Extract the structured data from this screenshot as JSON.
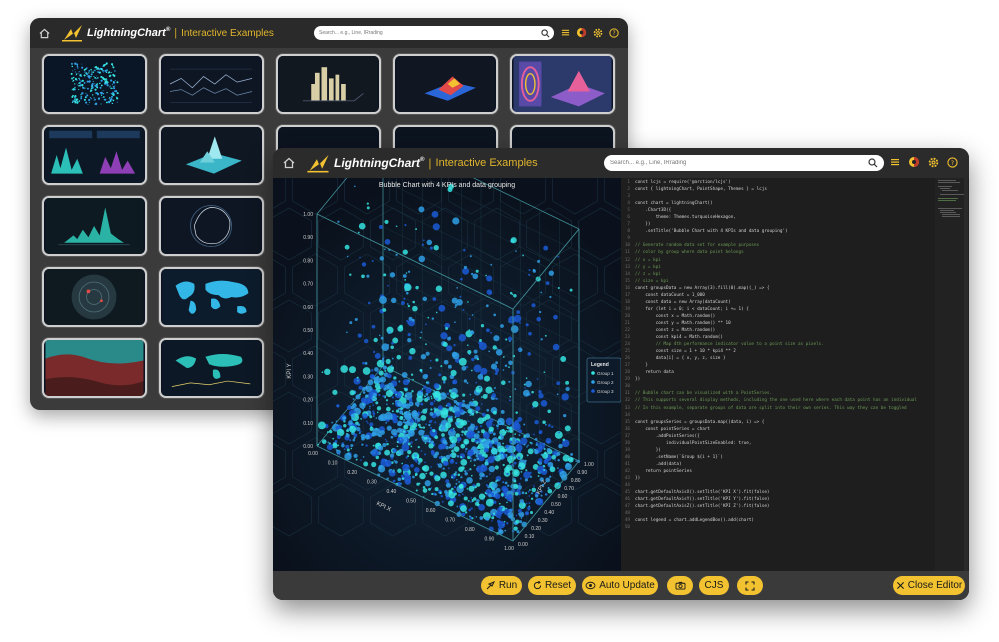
{
  "app": {
    "brand": "LightningChart",
    "brand_mark": "®",
    "subtitle": "Interactive Examples",
    "search_placeholder": "Search... e.g., Line, IRrading",
    "accent": "#f2c230",
    "icons": [
      "home-icon",
      "search-icon",
      "list-icon",
      "theme-icon",
      "settings-icon",
      "help-icon"
    ]
  },
  "gallery": {
    "thumbnails": [
      "scatter-3d",
      "line-series",
      "city-bars-3d",
      "surface-3d",
      "heatmap-surface",
      "dashboard",
      "surface-mesh",
      "",
      "",
      "",
      "bars-3d",
      "polar",
      "",
      "",
      "",
      "radar",
      "world-map",
      "",
      "",
      "",
      "heatmap-map",
      "map-lines",
      "",
      "",
      ""
    ]
  },
  "chart": {
    "title": "Bubble Chart with 4 KPIs and data grouping",
    "axis_x": "KPI X",
    "axis_y": "KPI Y",
    "axis_z": "KPI Z",
    "legend_title": "Legend",
    "groups": [
      "Group 1",
      "Group 2",
      "Group 3"
    ],
    "group_colors": [
      "#35e3e0",
      "#2f9fe6",
      "#1b5ad6"
    ],
    "ticks": [
      "0.00",
      "0.10",
      "0.20",
      "0.30",
      "0.40",
      "0.50",
      "0.60",
      "0.70",
      "0.80",
      "0.90",
      "1.00"
    ]
  },
  "chart_data": {
    "type": "scatter",
    "title": "Bubble Chart with 4 KPIs and data grouping",
    "xlabel": "KPI X",
    "ylabel": "KPI Y",
    "zlabel": "KPI Z",
    "xlim": [
      0,
      1
    ],
    "ylim": [
      0,
      1
    ],
    "zlim": [
      0,
      1
    ],
    "legend_position": "right",
    "series": [
      {
        "name": "Group 1",
        "color": "#35e3e0"
      },
      {
        "name": "Group 2",
        "color": "#2f9fe6"
      },
      {
        "name": "Group 3",
        "color": "#1b5ad6"
      }
    ]
  },
  "editor": {
    "lines": [
      {
        "n": "1",
        "t": "const lcjs = require('@arction/lcjs')",
        "c": false
      },
      {
        "n": "2",
        "t": "const { lightningChart, PointShape, Themes } = lcjs",
        "c": false
      },
      {
        "n": "3",
        "t": "",
        "c": false
      },
      {
        "n": "4",
        "t": "const chart = lightningChart()",
        "c": false
      },
      {
        "n": "5",
        "t": "    .Chart3D({",
        "c": false
      },
      {
        "n": "6",
        "t": "        theme: Themes.turquoiseHexagon,",
        "c": false
      },
      {
        "n": "7",
        "t": "    })",
        "c": false
      },
      {
        "n": "8",
        "t": "    .setTitle('Bubble Chart with 4 KPIs and data grouping')",
        "c": false
      },
      {
        "n": "9",
        "t": "",
        "c": false
      },
      {
        "n": "10",
        "t": "// Generate random data set for example purposes",
        "c": true
      },
      {
        "n": "11",
        "t": "// color by group where data point belongs",
        "c": true
      },
      {
        "n": "12",
        "t": "// x = kpi",
        "c": true
      },
      {
        "n": "13",
        "t": "// y = kpi",
        "c": true
      },
      {
        "n": "14",
        "t": "// z = kpi",
        "c": true
      },
      {
        "n": "15",
        "t": "// size = kpi",
        "c": true
      },
      {
        "n": "16",
        "t": "const groupsData = new Array(3).fill(0).map((_) => {",
        "c": false
      },
      {
        "n": "17",
        "t": "    const dataCount = 1_000",
        "c": false
      },
      {
        "n": "18",
        "t": "    const data = new Array(dataCount)",
        "c": false
      },
      {
        "n": "19",
        "t": "    for (let i = 0; i < dataCount; i += 1) {",
        "c": false
      },
      {
        "n": "20",
        "t": "        const x = Math.random()",
        "c": false
      },
      {
        "n": "21",
        "t": "        const y = Math.random() ** 10",
        "c": false
      },
      {
        "n": "22",
        "t": "        const z = Math.random()",
        "c": false
      },
      {
        "n": "23",
        "t": "        const kpi4 = Math.random()",
        "c": false
      },
      {
        "n": "24",
        "t": "        // Map 4th performance indicator value to a point size as pixels.",
        "c": true
      },
      {
        "n": "25",
        "t": "        const size = 1 + 10 * kpi4 ** 2",
        "c": false
      },
      {
        "n": "26",
        "t": "        data[i] = { x, y, z, size }",
        "c": false
      },
      {
        "n": "27",
        "t": "    }",
        "c": false
      },
      {
        "n": "28",
        "t": "    return data",
        "c": false
      },
      {
        "n": "29",
        "t": "})",
        "c": false
      },
      {
        "n": "30",
        "t": "",
        "c": false
      },
      {
        "n": "31",
        "t": "// Bubble chart can be visualized with a PointSeries.",
        "c": true
      },
      {
        "n": "32",
        "t": "// This supports several display methods, including the one used here where each data point has an individual",
        "c": true
      },
      {
        "n": "33",
        "t": "// In this example, separate groups of data are split into their own series. This way they can be toggled",
        "c": true
      },
      {
        "n": "34",
        "t": "",
        "c": false
      },
      {
        "n": "35",
        "t": "const groupsSeries = groupsData.map((data, i) => {",
        "c": false
      },
      {
        "n": "36",
        "t": "    const pointSeries = chart",
        "c": false
      },
      {
        "n": "37",
        "t": "        .addPointSeries({",
        "c": false
      },
      {
        "n": "38",
        "t": "            individualPointSizeEnabled: true,",
        "c": false
      },
      {
        "n": "39",
        "t": "        })",
        "c": false
      },
      {
        "n": "40",
        "t": "        .setName(`Group ${i + 1}`)",
        "c": false
      },
      {
        "n": "41",
        "t": "        .add(data)",
        "c": false
      },
      {
        "n": "42",
        "t": "    return pointSeries",
        "c": false
      },
      {
        "n": "43",
        "t": "})",
        "c": false
      },
      {
        "n": "44",
        "t": "",
        "c": false
      },
      {
        "n": "45",
        "t": "chart.getDefaultAxisX().setTitle('KPI X').fit(false)",
        "c": false
      },
      {
        "n": "46",
        "t": "chart.getDefaultAxisY().setTitle('KPI Y').fit(false)",
        "c": false
      },
      {
        "n": "47",
        "t": "chart.getDefaultAxisZ().setTitle('KPI Z').fit(false)",
        "c": false
      },
      {
        "n": "48",
        "t": "",
        "c": false
      },
      {
        "n": "49",
        "t": "const legend = chart.addLegendBox().add(chart)",
        "c": false
      },
      {
        "n": "50",
        "t": "",
        "c": false
      }
    ]
  },
  "toolbar": {
    "run": "Run",
    "reset": "Reset",
    "auto_update": "Auto Update",
    "cjs": "CJS",
    "close_editor": "Close Editor"
  }
}
